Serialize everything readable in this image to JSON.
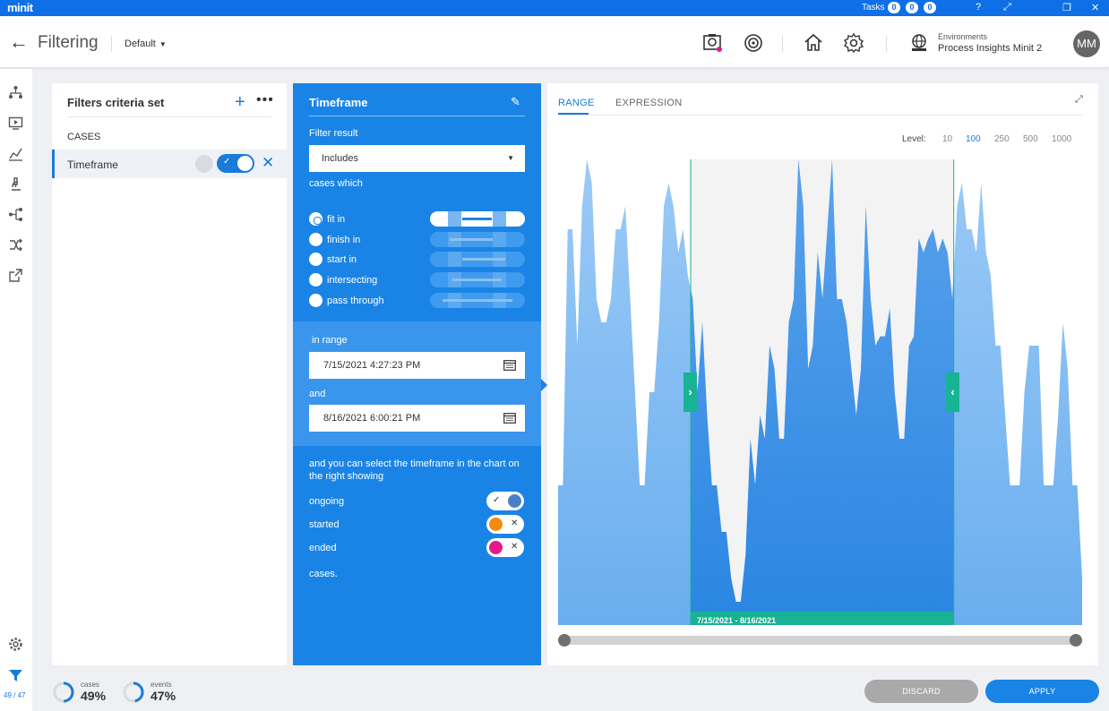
{
  "app": {
    "logo": "minit",
    "tasks_label": "Tasks",
    "task_counts": [
      "0",
      "0",
      "0"
    ],
    "window_buttons": [
      "?",
      "⤢",
      "❐",
      "✕"
    ]
  },
  "header": {
    "title": "Filtering",
    "profile": "Default",
    "env_label": "Environments",
    "env_value": "Process Insights Minit 2",
    "avatar": "MM"
  },
  "rail": {
    "count": "49 / 47"
  },
  "criteria": {
    "title": "Filters criteria set",
    "section": "CASES",
    "items": [
      {
        "label": "Timeframe",
        "enabled": true
      }
    ]
  },
  "timeframe": {
    "title": "Timeframe",
    "filter_result_label": "Filter result",
    "filter_result_value": "Includes",
    "cases_which": "cases which",
    "options": [
      "fit in",
      "finish in",
      "start in",
      "intersecting",
      "pass through"
    ],
    "selected_option": "fit in",
    "in_range": "in range",
    "from": "7/15/2021 4:27:23 PM",
    "and": "and",
    "to": "8/16/2021 6:00:21 PM",
    "select_note": "and you can select the timeframe in the chart on the right showing",
    "toggles": [
      {
        "label": "ongoing",
        "on": true,
        "color": "#3a7dd8"
      },
      {
        "label": "started",
        "on": false,
        "color": "#f28c0f"
      },
      {
        "label": "ended",
        "on": false,
        "color": "#e6198c"
      }
    ],
    "cases_end": "cases."
  },
  "chart_panel": {
    "tabs": [
      "RANGE",
      "EXPRESSION"
    ],
    "active_tab": "RANGE",
    "level_label": "Level:",
    "levels": [
      "10",
      "100",
      "250",
      "500",
      "1000"
    ],
    "active_level": "100",
    "selection_label": "7/15/2021 - 8/16/2021"
  },
  "chart_data": {
    "type": "area",
    "series": [
      {
        "values": [
          30,
          30,
          85,
          85,
          60,
          90,
          100,
          95,
          70,
          65,
          65,
          70,
          85,
          85,
          90,
          70,
          50,
          30,
          30,
          50,
          50,
          65,
          90,
          95,
          90,
          80,
          85,
          75,
          70,
          50,
          65,
          45,
          30,
          30,
          20,
          20,
          10,
          5,
          5,
          15,
          40,
          30,
          45,
          40,
          60,
          55,
          40,
          40,
          65,
          70,
          100,
          90,
          55,
          60,
          80,
          70,
          85,
          100,
          70,
          70,
          65,
          55,
          45,
          55,
          90,
          70,
          60,
          62,
          62,
          68,
          50,
          40,
          40,
          60,
          62,
          83,
          80,
          83,
          85,
          80,
          83,
          80,
          70,
          90,
          95,
          85,
          85,
          80,
          95,
          80,
          75,
          60,
          60,
          45,
          30,
          30,
          30,
          50,
          60,
          60,
          60,
          30,
          30,
          30,
          45,
          65,
          55,
          30,
          30,
          10
        ]
      }
    ],
    "selection": {
      "start_fraction": 0.253,
      "end_fraction": 0.755
    },
    "colors": {
      "area": "#7ab6f2",
      "selected_area": "#2f8ae6",
      "selection_bg": "#f3f3f3",
      "range_bar": "#17b394"
    }
  },
  "footer": {
    "cases_label": "cases",
    "cases_value": "49%",
    "events_label": "events",
    "events_value": "47%",
    "discard": "DISCARD",
    "apply": "APPLY"
  }
}
